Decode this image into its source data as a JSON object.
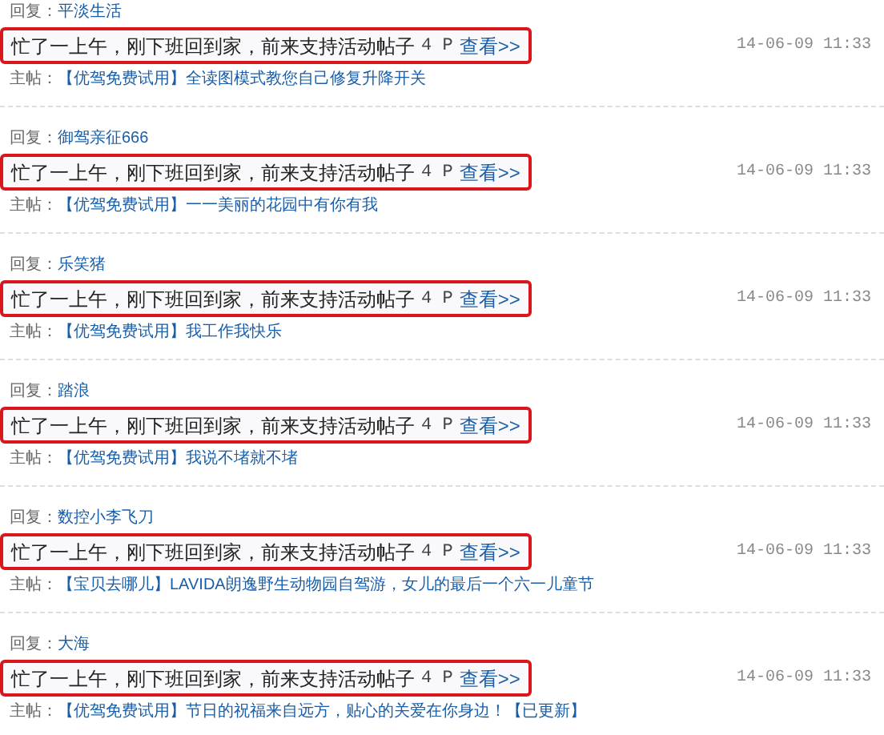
{
  "replies": [
    {
      "reply_label": "回复：",
      "user": "平淡生活",
      "message": "忙了一上午，刚下班回到家，前来支持活动帖子",
      "pages": "4 P",
      "view_link": "查看>>",
      "time": "14-06-09 11:33",
      "thread_label": "主帖：",
      "thread_title": "【优驾免费试用】全读图模式教您自己修复升降开关"
    },
    {
      "reply_label": "回复：",
      "user": "御驾亲征666",
      "message": "忙了一上午，刚下班回到家，前来支持活动帖子",
      "pages": "4 P",
      "view_link": "查看>>",
      "time": "14-06-09 11:33",
      "thread_label": "主帖：",
      "thread_title": "【优驾免费试用】一一美丽的花园中有你有我"
    },
    {
      "reply_label": "回复：",
      "user": "乐笑猪",
      "message": "忙了一上午，刚下班回到家，前来支持活动帖子",
      "pages": "4 P",
      "view_link": "查看>>",
      "time": "14-06-09 11:33",
      "thread_label": "主帖：",
      "thread_title": "【优驾免费试用】我工作我快乐"
    },
    {
      "reply_label": "回复：",
      "user": "踏浪",
      "message": "忙了一上午，刚下班回到家，前来支持活动帖子",
      "pages": "4 P",
      "view_link": "查看>>",
      "time": "14-06-09 11:33",
      "thread_label": "主帖：",
      "thread_title": "【优驾免费试用】我说不堵就不堵"
    },
    {
      "reply_label": "回复：",
      "user": "数控小李飞刀",
      "message": "忙了一上午，刚下班回到家，前来支持活动帖子",
      "pages": "4 P",
      "view_link": "查看>>",
      "time": "14-06-09 11:33",
      "thread_label": "主帖：",
      "thread_title": "【宝贝去哪儿】LAVIDA朗逸野生动物园自驾游，女儿的最后一个六一儿童节"
    },
    {
      "reply_label": "回复：",
      "user": "大海",
      "message": "忙了一上午，刚下班回到家，前来支持活动帖子",
      "pages": "4 P",
      "view_link": "查看>>",
      "time": "14-06-09 11:33",
      "thread_label": "主帖：",
      "thread_title": "【优驾免费试用】节日的祝福来自远方，贴心的关爱在你身边！【已更新】"
    }
  ]
}
